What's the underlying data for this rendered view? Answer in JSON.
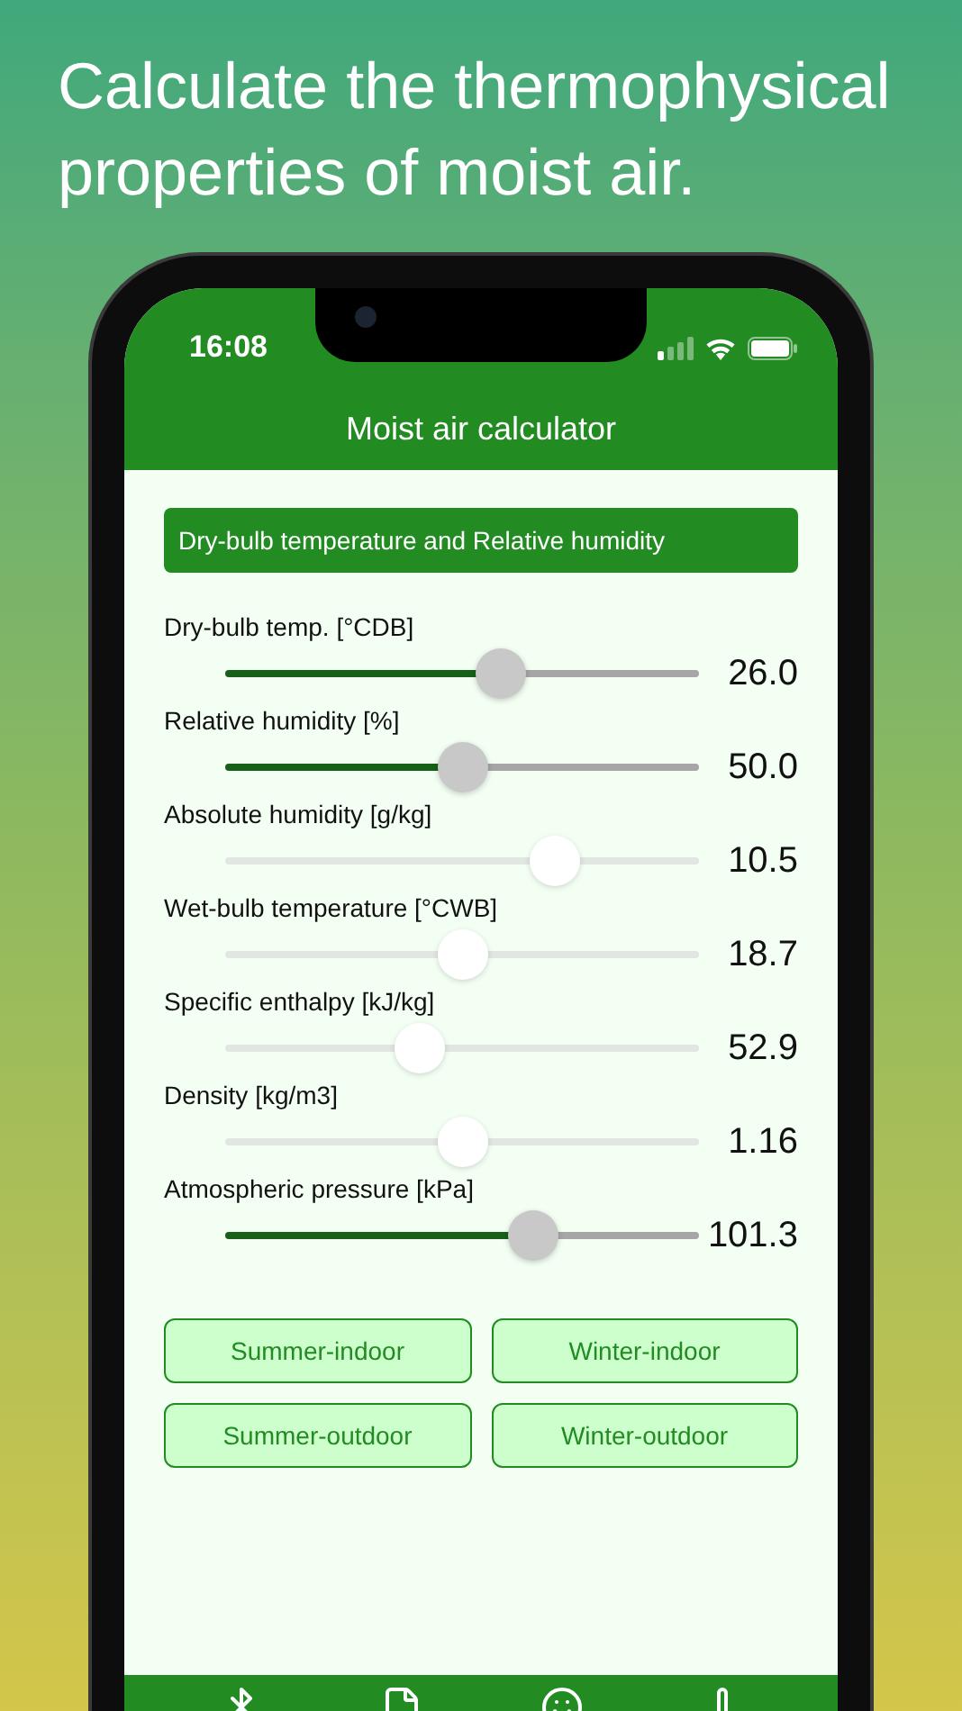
{
  "headline": "Calculate the thermophysical properties of moist air.",
  "status_bar": {
    "time": "16:08"
  },
  "header": {
    "title": "Moist air calculator"
  },
  "mode_selector": {
    "value": "Dry-bulb temperature and Relative humidity"
  },
  "parameters": [
    {
      "label": "Dry-bulb temp. [°CDB]",
      "value": "26.0",
      "level": 0.59,
      "disabled": false
    },
    {
      "label": "Relative humidity [%]",
      "value": "50.0",
      "level": 0.5,
      "disabled": false
    },
    {
      "label": "Absolute humidity [g/kg]",
      "value": "10.5",
      "level": 0.72,
      "disabled": true
    },
    {
      "label": "Wet-bulb temperature [°CWB]",
      "value": "18.7",
      "level": 0.5,
      "disabled": true
    },
    {
      "label": "Specific enthalpy [kJ/kg]",
      "value": "52.9",
      "level": 0.4,
      "disabled": true
    },
    {
      "label": "Density [kg/m3]",
      "value": "1.16",
      "level": 0.5,
      "disabled": true
    },
    {
      "label": "Atmospheric pressure [kPa]",
      "value": "101.3",
      "level": 0.67,
      "disabled": false
    }
  ],
  "presets": [
    {
      "label": "Summer-indoor"
    },
    {
      "label": "Winter-indoor"
    },
    {
      "label": "Summer-outdoor"
    },
    {
      "label": "Winter-outdoor"
    }
  ]
}
